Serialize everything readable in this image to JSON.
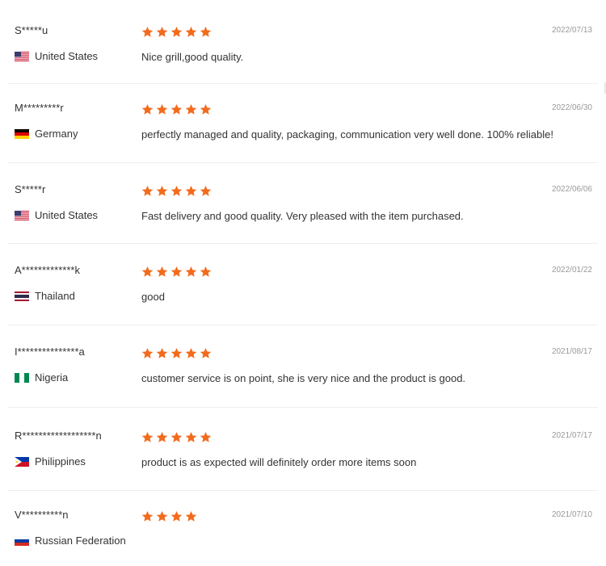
{
  "reviews": [
    {
      "reviewer": "S*****u",
      "country": "United States",
      "flag": "flag-us-icon",
      "rating": 5,
      "comment": "Nice grill,good quality.",
      "date": "2022/07/13"
    },
    {
      "reviewer": "M*********r",
      "country": "Germany",
      "flag": "flag-de-icon",
      "rating": 5,
      "comment": "perfectly managed and quality, packaging, communication very well done. 100% reliable!",
      "date": "2022/06/30"
    },
    {
      "reviewer": "S*****r",
      "country": "United States",
      "flag": "flag-us-icon",
      "rating": 5,
      "comment": "Fast delivery and good quality. Very pleased with the item purchased.",
      "date": "2022/06/06"
    },
    {
      "reviewer": "A*************k",
      "country": "Thailand",
      "flag": "flag-th-icon",
      "rating": 5,
      "comment": "good",
      "date": "2022/01/22"
    },
    {
      "reviewer": "I***************a",
      "country": "Nigeria",
      "flag": "flag-ng-icon",
      "rating": 5,
      "comment": "customer service is on point, she is very nice and the product is good.",
      "date": "2021/08/17"
    },
    {
      "reviewer": "R******************n",
      "country": "Philippines",
      "flag": "flag-ph-icon",
      "rating": 5,
      "comment": "product is as expected will definitely order more items soon",
      "date": "2021/07/17"
    },
    {
      "reviewer": "V**********n",
      "country": "Russian Federation",
      "flag": "flag-ru-icon",
      "rating": 4,
      "comment": "",
      "date": "2021/07/10"
    }
  ],
  "colors": {
    "star": "#f26b1d",
    "divider": "#eeeeee",
    "date": "#999999",
    "text": "#333333"
  }
}
